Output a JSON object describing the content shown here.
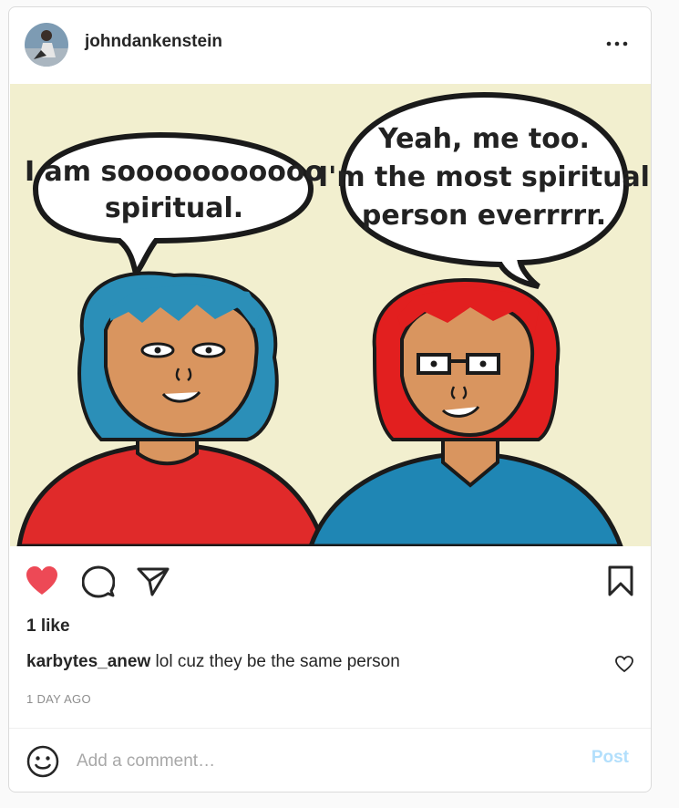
{
  "post": {
    "username": "johndankenstein",
    "more_icon": "ellipsis-icon",
    "image": {
      "speech_left": [
        "I am sooooooooooo",
        "spiritual."
      ],
      "speech_right": [
        "Yeah, me too.",
        "I'm the most spiritual",
        "person everrrrr."
      ],
      "colors": {
        "background": "#f2efcf",
        "left_hair": "#2b8fb8",
        "left_shirt": "#e02a2a",
        "right_hair": "#e21f1f",
        "right_shirt": "#1f86b4",
        "skin": "#d9955f"
      }
    },
    "actions": {
      "like_icon": "heart-filled-icon",
      "comment_icon": "comment-icon",
      "share_icon": "share-icon",
      "save_icon": "bookmark-icon",
      "liked_color": "#ed4956"
    },
    "likes": "1 like",
    "comments": [
      {
        "user": "karbytes_anew",
        "text": "lol cuz they be the same person"
      }
    ],
    "time": "1 DAY AGO",
    "add_comment": {
      "placeholder": "Add a comment…",
      "post_label": "Post",
      "post_color": "#b2dffc"
    }
  }
}
